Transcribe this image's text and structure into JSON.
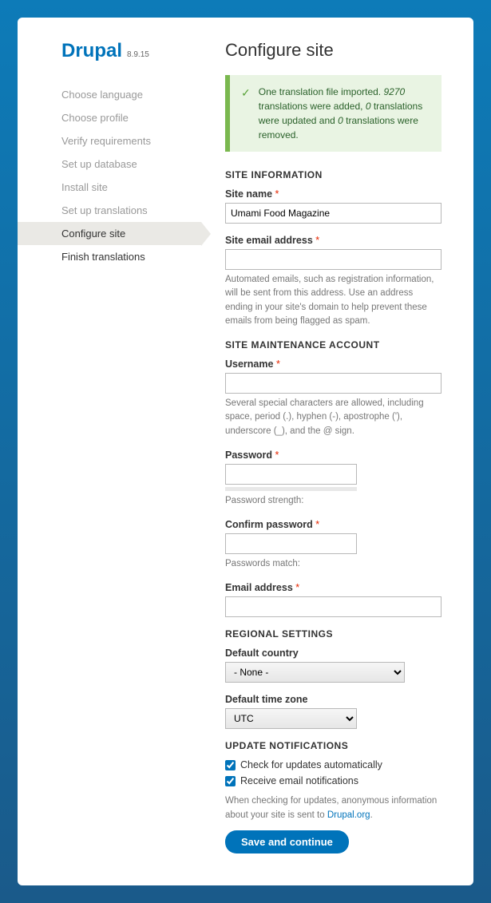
{
  "logo": "Drupal",
  "version": "8.9.15",
  "steps": [
    {
      "label": "Choose language",
      "state": "done"
    },
    {
      "label": "Choose profile",
      "state": "done"
    },
    {
      "label": "Verify requirements",
      "state": "done"
    },
    {
      "label": "Set up database",
      "state": "done"
    },
    {
      "label": "Install site",
      "state": "done"
    },
    {
      "label": "Set up translations",
      "state": "done"
    },
    {
      "label": "Configure site",
      "state": "current"
    },
    {
      "label": "Finish translations",
      "state": "todo"
    }
  ],
  "page_title": "Configure site",
  "alert": {
    "prefix": "One translation file imported. ",
    "count1": "9270",
    "mid1": " translations were added, ",
    "count2": "0",
    "mid2": " translations were updated and ",
    "count3": "0",
    "mid3": " translations were removed."
  },
  "sections": {
    "site_info": "SITE INFORMATION",
    "site_maint": "SITE MAINTENANCE ACCOUNT",
    "regional": "REGIONAL SETTINGS",
    "update": "UPDATE NOTIFICATIONS"
  },
  "fields": {
    "site_name": {
      "label": "Site name",
      "value": "Umami Food Magazine"
    },
    "site_email": {
      "label": "Site email address",
      "value": "",
      "help": "Automated emails, such as registration information, will be sent from this address. Use an address ending in your site's domain to help prevent these emails from being flagged as spam."
    },
    "username": {
      "label": "Username",
      "value": "",
      "help": "Several special characters are allowed, including space, period (.), hyphen (-), apostrophe ('), underscore (_), and the @ sign."
    },
    "password": {
      "label": "Password",
      "value": "",
      "strength_label": "Password strength:"
    },
    "confirm_password": {
      "label": "Confirm password",
      "value": "",
      "match_label": "Passwords match:"
    },
    "email": {
      "label": "Email address",
      "value": ""
    },
    "country": {
      "label": "Default country",
      "value": "- None -"
    },
    "timezone": {
      "label": "Default time zone",
      "value": "UTC"
    },
    "check_updates": {
      "label": "Check for updates automatically",
      "checked": true
    },
    "email_notify": {
      "label": "Receive email notifications",
      "checked": true
    },
    "update_help_prefix": "When checking for updates, anonymous information about your site is sent to ",
    "update_help_link": "Drupal.org",
    "update_help_suffix": "."
  },
  "submit_label": "Save and continue"
}
